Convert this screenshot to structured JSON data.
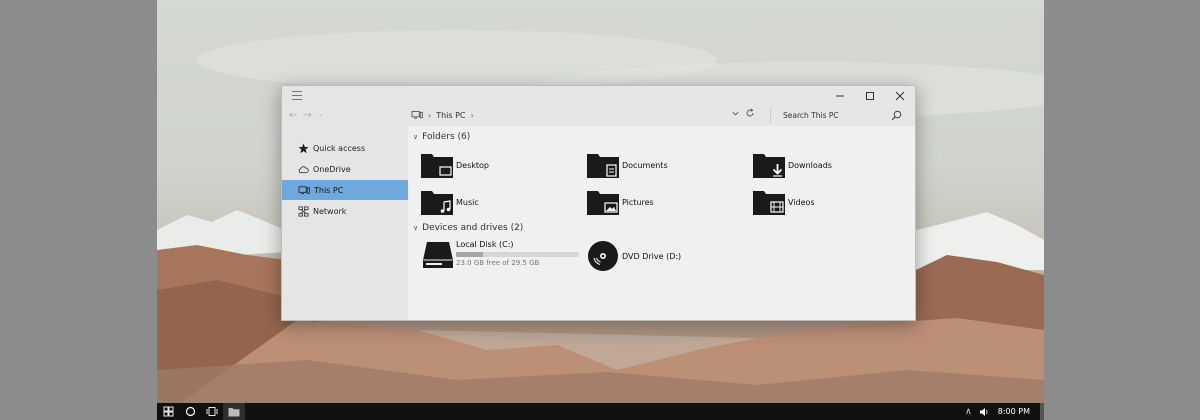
{
  "window": {
    "location_path": [
      "This PC"
    ],
    "search_placeholder": "Search This PC"
  },
  "nav": {
    "items": [
      {
        "label": "Quick access",
        "icon": "star-icon",
        "selected": false
      },
      {
        "label": "OneDrive",
        "icon": "cloud-icon",
        "selected": false
      },
      {
        "label": "This PC",
        "icon": "computer-icon",
        "selected": true
      },
      {
        "label": "Network",
        "icon": "network-icon",
        "selected": false
      }
    ]
  },
  "folders": {
    "heading": "Folders (6)",
    "items": [
      {
        "label": "Desktop",
        "icon": "desktop-folder-icon"
      },
      {
        "label": "Documents",
        "icon": "documents-folder-icon"
      },
      {
        "label": "Downloads",
        "icon": "downloads-folder-icon"
      },
      {
        "label": "Music",
        "icon": "music-folder-icon"
      },
      {
        "label": "Pictures",
        "icon": "pictures-folder-icon"
      },
      {
        "label": "Videos",
        "icon": "videos-folder-icon"
      }
    ]
  },
  "drives": {
    "heading": "Devices and drives (2)",
    "items": [
      {
        "label": "Local Disk (C:)",
        "free_text": "23.0 GB free of 29.5 GB",
        "used_fraction": 0.22,
        "icon": "hard-drive-icon"
      },
      {
        "label": "DVD Drive (D:)",
        "icon": "dvd-drive-icon"
      }
    ]
  },
  "taskbar": {
    "clock": "8:00 PM"
  },
  "colors": {
    "selection": "#6fa8dc",
    "taskbar": "#101010",
    "icon_fill": "#1a1a1a"
  }
}
